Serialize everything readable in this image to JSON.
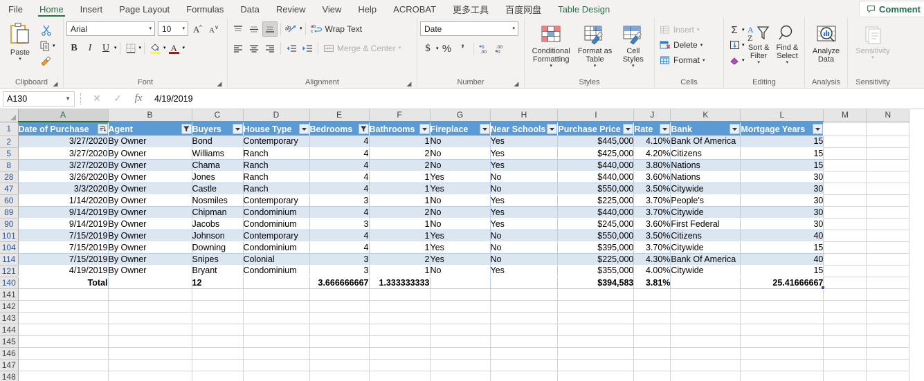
{
  "ribbon": {
    "tabs": [
      {
        "label": "File",
        "active": false
      },
      {
        "label": "Home",
        "active": true
      },
      {
        "label": "Insert",
        "active": false
      },
      {
        "label": "Page Layout",
        "active": false
      },
      {
        "label": "Formulas",
        "active": false
      },
      {
        "label": "Data",
        "active": false
      },
      {
        "label": "Review",
        "active": false
      },
      {
        "label": "View",
        "active": false
      },
      {
        "label": "Help",
        "active": false
      },
      {
        "label": "ACROBAT",
        "active": false
      },
      {
        "label": "更多工具",
        "active": false
      },
      {
        "label": "百度网盘",
        "active": false
      },
      {
        "label": "Table Design",
        "active": false,
        "contextual": true
      }
    ],
    "comment_button": {
      "label": "Comment",
      "icon": "comment-icon"
    },
    "groups": {
      "clipboard": {
        "label": "Clipboard",
        "paste_label": "Paste",
        "cut_icon": "scissors-icon",
        "copy_icon": "copy-icon",
        "format_painter_icon": "format-painter-icon",
        "launcher_icon": "dialog-launcher-icon"
      },
      "font": {
        "label": "Font",
        "font_name": "Arial",
        "font_size": "10",
        "grow_font_icon": "grow-font-icon",
        "shrink_font_icon": "shrink-font-icon",
        "bold_label": "B",
        "italic_label": "I",
        "underline_label": "U",
        "borders_icon": "borders-icon",
        "fill_color_icon": "fill-color-icon",
        "font_color_icon": "font-color-icon",
        "launcher_icon": "dialog-launcher-icon"
      },
      "alignment": {
        "label": "Alignment",
        "align_top_icon": "align-top-icon",
        "align_middle_icon": "align-middle-icon",
        "align_bottom_icon": "align-bottom-icon",
        "orientation_icon": "orientation-icon",
        "wrap_text_label": "Wrap Text",
        "align_left_icon": "align-left-icon",
        "align_center_icon": "align-center-icon",
        "align_right_icon": "align-right-icon",
        "decrease_indent_icon": "decrease-indent-icon",
        "increase_indent_icon": "increase-indent-icon",
        "merge_center_label": "Merge & Center",
        "launcher_icon": "dialog-launcher-icon"
      },
      "number": {
        "label": "Number",
        "format_value": "Date",
        "currency_label": "$",
        "percent_label": "%",
        "comma_label": "’",
        "increase_decimal_icon": "increase-decimal-icon",
        "decrease_decimal_icon": "decrease-decimal-icon",
        "launcher_icon": "dialog-launcher-icon"
      },
      "styles": {
        "label": "Styles",
        "conditional_formatting_label": "Conditional\nFormatting",
        "format_as_table_label": "Format as\nTable",
        "cell_styles_label": "Cell\nStyles"
      },
      "cells": {
        "label": "Cells",
        "insert_label": "Insert",
        "delete_label": "Delete",
        "format_label": "Format"
      },
      "editing": {
        "label": "Editing",
        "autosum_icon": "autosum-icon",
        "fill_icon": "fill-icon",
        "clear_icon": "clear-icon",
        "sort_filter_label": "Sort &\nFilter",
        "find_select_label": "Find &\nSelect"
      },
      "analysis": {
        "label": "Analysis",
        "analyze_data_label": "Analyze\nData"
      },
      "sensitivity": {
        "label": "Sensitivity",
        "sensitivity_label": "Sensitivity"
      }
    }
  },
  "formula_bar": {
    "name_box_value": "A130",
    "cancel_icon": "cancel-icon",
    "enter_icon": "enter-icon",
    "function_icon": "fx-icon",
    "formula_value": "4/19/2019"
  },
  "sheet": {
    "column_letters": [
      "A",
      "B",
      "C",
      "D",
      "E",
      "F",
      "G",
      "H",
      "I",
      "J",
      "K",
      "L",
      "M",
      "N"
    ],
    "selected_column": "A",
    "table_header_row_number": "1",
    "headers": [
      {
        "label": "Date of Purchase",
        "filter": "sort-desc-filter"
      },
      {
        "label": "Agent",
        "filter": "filtered"
      },
      {
        "label": "Buyers",
        "filter": "none"
      },
      {
        "label": "House Type",
        "filter": "none"
      },
      {
        "label": "Bedrooms",
        "filter": "filtered"
      },
      {
        "label": "Bathrooms",
        "filter": "none"
      },
      {
        "label": "Fireplace",
        "filter": "none"
      },
      {
        "label": "Near Schools",
        "filter": "none"
      },
      {
        "label": "Purchase Price",
        "filter": "none"
      },
      {
        "label": "Rate",
        "filter": "none"
      },
      {
        "label": "Bank",
        "filter": "none"
      },
      {
        "label": "Mortgage Years",
        "filter": "none"
      }
    ],
    "rows": [
      {
        "n": "2",
        "cells": [
          "3/27/2020",
          "By Owner",
          "Bond",
          "Contemporary",
          "4",
          "1",
          "No",
          "Yes",
          "$445,000",
          "4.10%",
          "Bank Of America",
          "15"
        ]
      },
      {
        "n": "5",
        "cells": [
          "3/27/2020",
          "By Owner",
          "Williams",
          "Ranch",
          "4",
          "2",
          "No",
          "Yes",
          "$425,000",
          "4.20%",
          "Citizens",
          "15"
        ]
      },
      {
        "n": "8",
        "cells": [
          "3/27/2020",
          "By Owner",
          "Chama",
          "Ranch",
          "4",
          "2",
          "No",
          "Yes",
          "$440,000",
          "3.80%",
          "Nations",
          "15"
        ]
      },
      {
        "n": "28",
        "cells": [
          "3/26/2020",
          "By Owner",
          "Jones",
          "Ranch",
          "4",
          "1",
          "Yes",
          "No",
          "$440,000",
          "3.60%",
          "Nations",
          "30"
        ]
      },
      {
        "n": "47",
        "cells": [
          "3/3/2020",
          "By Owner",
          "Castle",
          "Ranch",
          "4",
          "1",
          "Yes",
          "No",
          "$550,000",
          "3.50%",
          "Citywide",
          "30"
        ]
      },
      {
        "n": "60",
        "cells": [
          "1/14/2020",
          "By Owner",
          "Nosmiles",
          "Contemporary",
          "3",
          "1",
          "No",
          "Yes",
          "$225,000",
          "3.70%",
          "People's",
          "30"
        ]
      },
      {
        "n": "89",
        "cells": [
          "9/14/2019",
          "By Owner",
          "Chipman",
          "Condominium",
          "4",
          "2",
          "No",
          "Yes",
          "$440,000",
          "3.70%",
          "Citywide",
          "30"
        ]
      },
      {
        "n": "90",
        "cells": [
          "9/14/2019",
          "By Owner",
          "Jacobs",
          "Condominium",
          "3",
          "1",
          "No",
          "Yes",
          "$245,000",
          "3.60%",
          "First Federal",
          "30"
        ]
      },
      {
        "n": "101",
        "cells": [
          "7/15/2019",
          "By Owner",
          "Johnson",
          "Contemporary",
          "4",
          "1",
          "Yes",
          "No",
          "$550,000",
          "3.50%",
          "Citizens",
          "40"
        ]
      },
      {
        "n": "104",
        "cells": [
          "7/15/2019",
          "By Owner",
          "Downing",
          "Condominium",
          "4",
          "1",
          "Yes",
          "No",
          "$395,000",
          "3.70%",
          "Citywide",
          "15"
        ]
      },
      {
        "n": "114",
        "cells": [
          "7/15/2019",
          "By Owner",
          "Snipes",
          "Colonial",
          "3",
          "2",
          "Yes",
          "No",
          "$225,000",
          "4.30%",
          "Bank Of America",
          "40"
        ]
      },
      {
        "n": "121",
        "cells": [
          "4/19/2019",
          "By Owner",
          "Bryant",
          "Condominium",
          "3",
          "1",
          "No",
          "Yes",
          "$355,000",
          "4.00%",
          "Citywide",
          "15"
        ]
      }
    ],
    "total_row": {
      "n": "140",
      "cells": [
        "Total",
        "",
        "12",
        "",
        "3.666666667",
        "1.333333333",
        "",
        "",
        "$394,583",
        "3.81%",
        "",
        "25.41666667"
      ]
    },
    "empty_row_numbers": [
      "141",
      "142",
      "143",
      "144",
      "145",
      "146",
      "147",
      "148"
    ]
  }
}
